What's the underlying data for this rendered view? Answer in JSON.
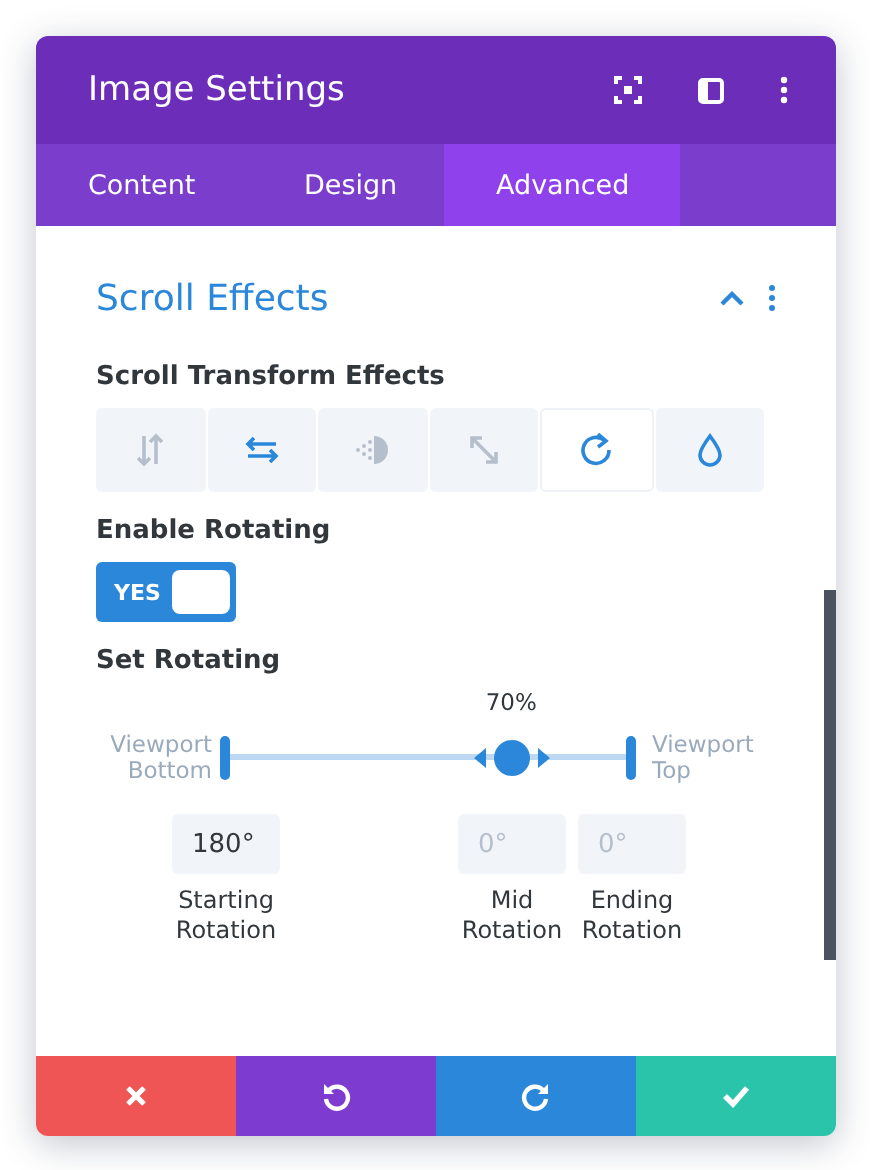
{
  "window": {
    "title": "Image Settings"
  },
  "tabs": [
    {
      "label": "Content",
      "selected": false
    },
    {
      "label": "Design",
      "selected": false
    },
    {
      "label": "Advanced",
      "selected": true
    }
  ],
  "section": {
    "title": "Scroll Effects",
    "expanded": true
  },
  "effects_label": "Scroll Transform Effects",
  "effects": [
    {
      "kind": "vertical",
      "active": false,
      "selected": false
    },
    {
      "kind": "horizontal",
      "active": true,
      "selected": false
    },
    {
      "kind": "fade",
      "active": false,
      "selected": false
    },
    {
      "kind": "scale",
      "active": false,
      "selected": false
    },
    {
      "kind": "rotate",
      "active": true,
      "selected": true
    },
    {
      "kind": "blur",
      "active": true,
      "selected": false
    }
  ],
  "enable": {
    "label": "Enable Rotating",
    "on": true,
    "text": "YES"
  },
  "rotating": {
    "label": "Set Rotating",
    "percent": "70%",
    "level": 0.7,
    "left_label": "Viewport Bottom",
    "right_label": "Viewport Top",
    "fields": [
      {
        "value": "180°",
        "label": "Starting Rotation"
      },
      {
        "placeholder": "0°",
        "label": "Mid Rotation"
      },
      {
        "placeholder": "0°",
        "label": "Ending Rotation"
      }
    ]
  },
  "footer": [
    {
      "kind": "cancel"
    },
    {
      "kind": "undo"
    },
    {
      "kind": "redo"
    },
    {
      "kind": "save"
    }
  ]
}
